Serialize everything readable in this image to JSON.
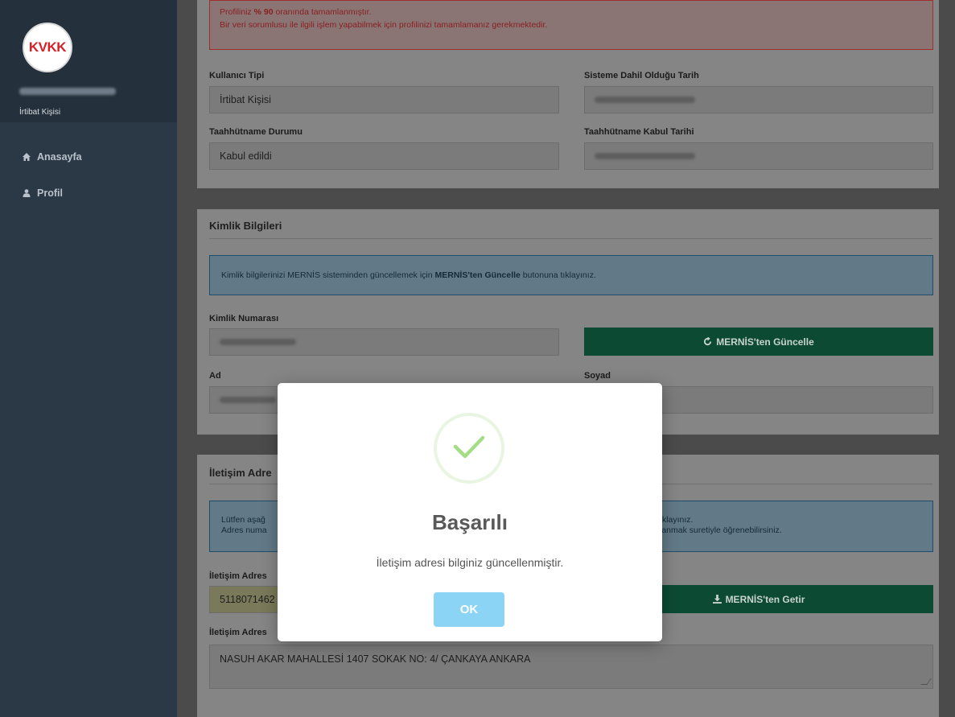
{
  "sidebar": {
    "logo_text": "KVKK",
    "user_role": "İrtibat Kişisi",
    "nav": [
      {
        "label": "Anasayfa",
        "icon": "home-icon"
      },
      {
        "label": "Profil",
        "icon": "user-icon"
      }
    ]
  },
  "profile_alert": {
    "line1_prefix": "Profiliniz ",
    "line1_percent": "% 90",
    "line1_suffix": " oranında tamamlanmıştır.",
    "line2": "Bir veri sorumlusu ile ilgili işlem yapabilmek için profilinizi tamamlamanız gerekmektedir."
  },
  "account": {
    "user_type_label": "Kullanıcı Tipi",
    "user_type_value": "İrtibat Kişisi",
    "join_date_label": "Sisteme Dahil Olduğu Tarih",
    "commitment_status_label": "Taahhütname Durumu",
    "commitment_status_value": "Kabul edildi",
    "commitment_date_label": "Taahhütname Kabul Tarihi"
  },
  "identity": {
    "title": "Kimlik Bilgileri",
    "info_prefix": "Kimlik bilgilerinizi MERNİS sisteminden güncellemek için ",
    "info_bold": "MERNİS'ten Güncelle",
    "info_suffix": " butonuna tıklayınız.",
    "id_label": "Kimlik Numarası",
    "update_button": "MERNİS'ten Güncelle",
    "name_label": "Ad",
    "surname_label": "Soyad"
  },
  "address": {
    "title": "İletişim Adre",
    "info_line1_left": "Lütfen aşağ",
    "info_line1_right": "ıklayınız.",
    "info_line2_left": "Adres numa",
    "info_line2_right": "lanmak suretiyle öğrenebilirsiniz.",
    "code_label": "İletişim Adres",
    "code_value": "5118071462",
    "fetch_button": "MERNİS'ten Getir",
    "address_label": "İletişim Adres",
    "address_value": "NASUH AKAR  MAHALLESİ 1407 SOKAK NO: 4/ ÇANKAYA ANKARA"
  },
  "modal": {
    "title": "Başarılı",
    "message": "İletişim adresi bilginiz güncellenmiştir.",
    "ok_label": "OK",
    "icon": "check-icon"
  },
  "colors": {
    "sidebar": "#2b3845",
    "success_green": "#a5dc86",
    "ok_button": "#8cd4f5",
    "mernis_button": "#0c4a34"
  }
}
